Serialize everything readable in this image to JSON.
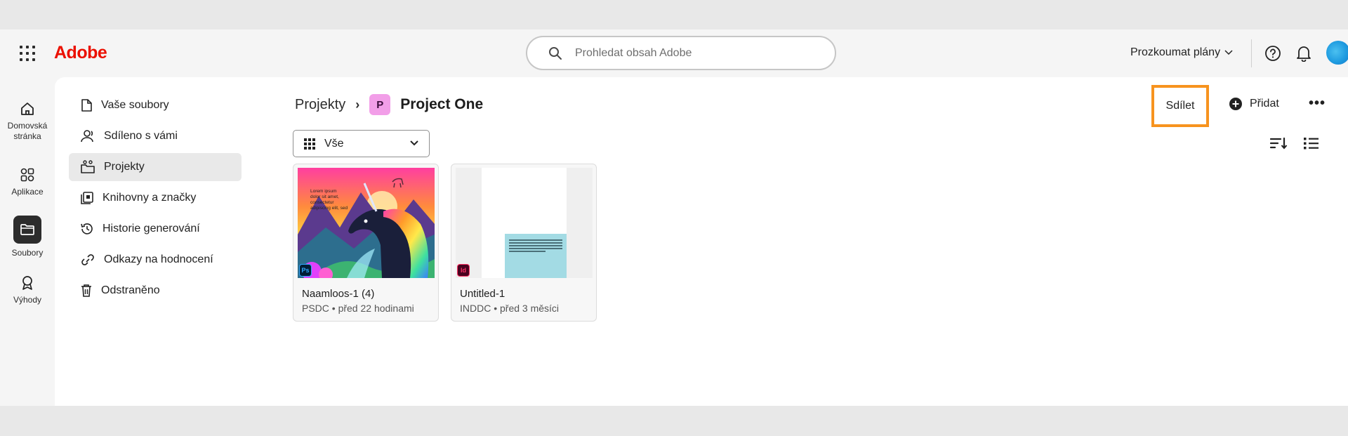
{
  "header": {
    "logo": "Adobe",
    "search_placeholder": "Prohledat obsah Adobe",
    "plans_label": "Prozkoumat plány"
  },
  "rail": {
    "items": [
      {
        "label": "Domovská stránka"
      },
      {
        "label": "Aplikace"
      },
      {
        "label": "Soubory"
      },
      {
        "label": "Výhody"
      }
    ]
  },
  "nav": {
    "items": [
      {
        "label": "Vaše soubory"
      },
      {
        "label": "Sdíleno s vámi"
      },
      {
        "label": "Projekty"
      },
      {
        "label": "Knihovny a značky"
      },
      {
        "label": "Historie generování"
      },
      {
        "label": "Odkazy na hodnocení"
      },
      {
        "label": "Odstraněno"
      }
    ]
  },
  "breadcrumb": {
    "root": "Projekty",
    "project_badge": "P",
    "project_name": "Project One"
  },
  "actions": {
    "share": "Sdílet",
    "add": "Přidat",
    "more": "•••"
  },
  "filter": {
    "selected": "Vše"
  },
  "files": [
    {
      "name": "Naamloos-1 (4)",
      "meta": "PSDC • před 22 hodinami",
      "app": "Ps"
    },
    {
      "name": "Untitled-1",
      "meta": "INDDC • před 3 měsíci",
      "app": "Id"
    }
  ],
  "thumb_text": [
    "Lorem ipsum",
    "dolor sit amet,",
    "consectetur",
    "adipiscing elit, sed"
  ],
  "colors": {
    "brand": "#eb1000",
    "highlight": "#f7931e",
    "project_badge": "#f29ee8",
    "photoshop": "#31a8ff",
    "indesign": "#ff3366"
  }
}
